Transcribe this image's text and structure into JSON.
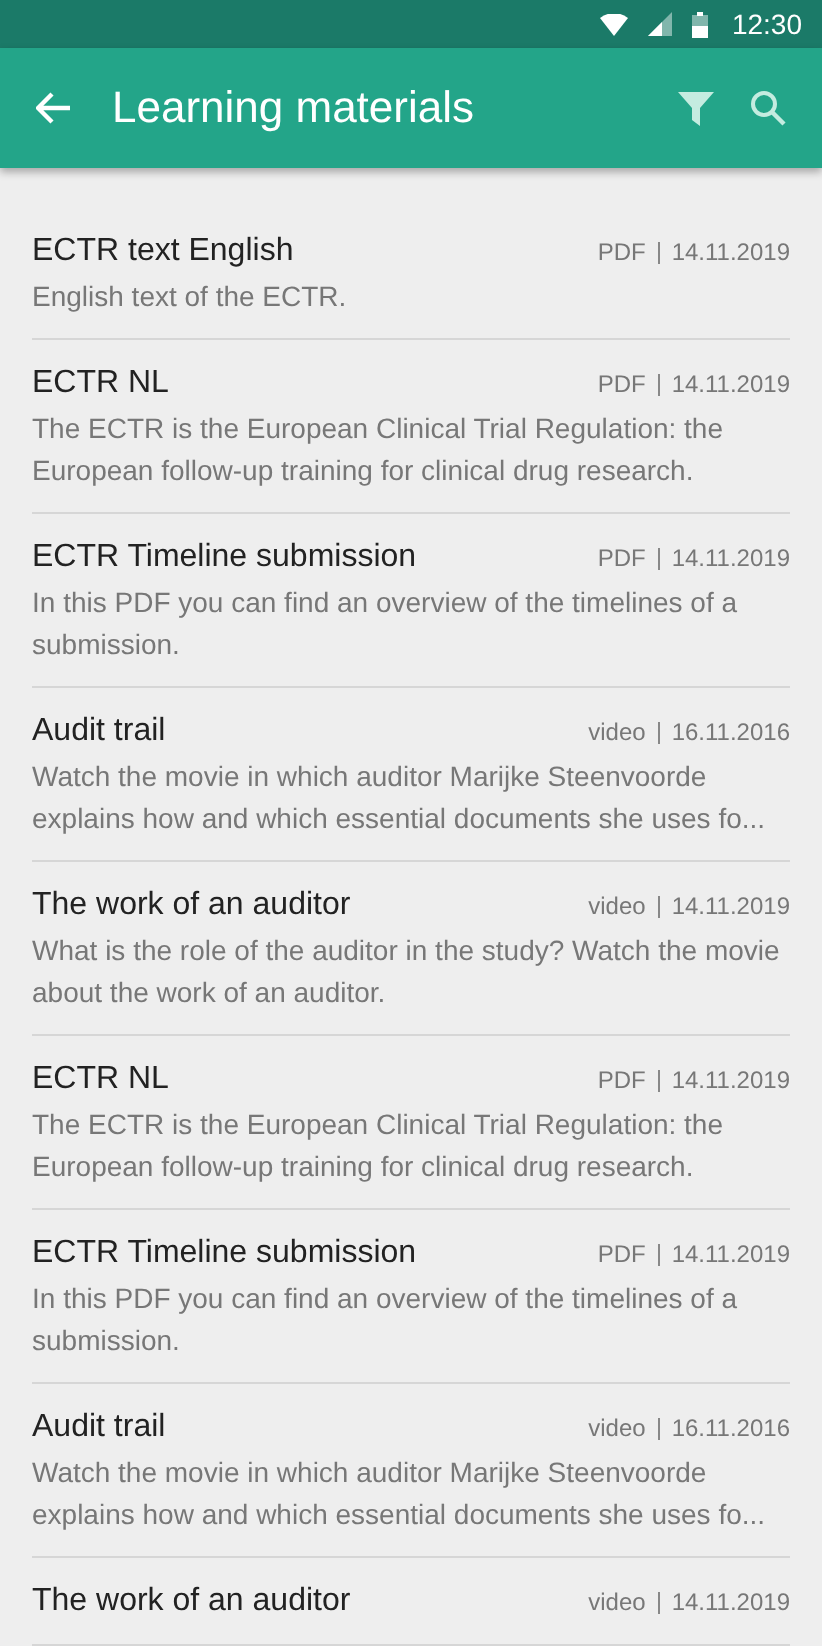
{
  "status_bar": {
    "time": "12:30"
  },
  "toolbar": {
    "title": "Learning materials"
  },
  "items": [
    {
      "title": "ECTR text English",
      "type": "PDF",
      "date": "14.11.2019",
      "description": "English text of the ECTR."
    },
    {
      "title": "ECTR NL",
      "type": "PDF",
      "date": "14.11.2019",
      "description": "The ECTR is the European Clinical Trial Regulation: the European follow-up training for clinical drug research."
    },
    {
      "title": "ECTR Timeline submission",
      "type": "PDF",
      "date": "14.11.2019",
      "description": "In this PDF you can find an overview of the timelines of a submission."
    },
    {
      "title": "Audit trail",
      "type": "video",
      "date": "16.11.2016",
      "description": "Watch the movie in which auditor Marijke Steenvoorde explains how and which essential documents she uses fo..."
    },
    {
      "title": "The work of an auditor",
      "type": "video",
      "date": "14.11.2019",
      "description": "What is the role of the auditor in the study? Watch the movie about the work of an auditor."
    },
    {
      "title": "ECTR NL",
      "type": "PDF",
      "date": "14.11.2019",
      "description": "The ECTR is the European Clinical Trial Regulation: the European follow-up training for clinical drug research."
    },
    {
      "title": "ECTR Timeline submission",
      "type": "PDF",
      "date": "14.11.2019",
      "description": "In this PDF you can find an overview of the timelines of a submission."
    },
    {
      "title": "Audit trail",
      "type": "video",
      "date": "16.11.2016",
      "description": "Watch the movie in which auditor Marijke Steenvoorde explains how and which essential documents she uses fo..."
    },
    {
      "title": "The work of an auditor",
      "type": "video",
      "date": "14.11.2019"
    }
  ]
}
